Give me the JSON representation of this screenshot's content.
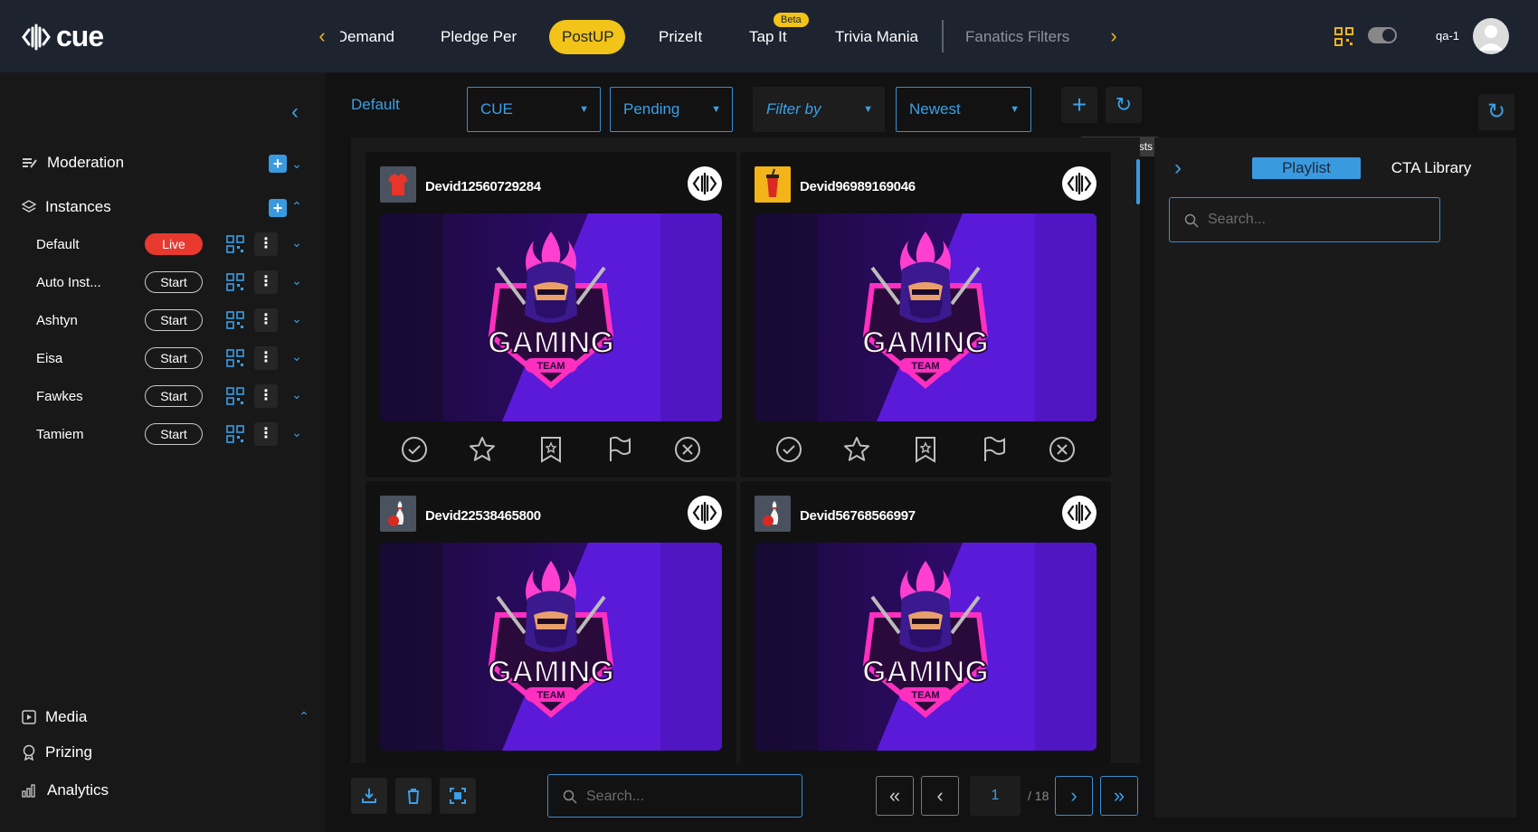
{
  "brand": {
    "name": "cue"
  },
  "nav": {
    "tabs": [
      {
        "label": "Demand",
        "state": "partial"
      },
      {
        "label": "Pledge Per",
        "state": "normal"
      },
      {
        "label": "PostUP",
        "state": "active"
      },
      {
        "label": "PrizeIt",
        "state": "normal"
      },
      {
        "label": "Tap It",
        "state": "normal",
        "badge": "Beta"
      },
      {
        "label": "Trivia Mania",
        "state": "normal"
      },
      {
        "label": "Fanatics Filters",
        "state": "disabled"
      }
    ],
    "prev_icon": "chevron-left-icon",
    "next_icon": "chevron-right-icon"
  },
  "header": {
    "username": "qa-1",
    "qr_icon": "qr-code-icon",
    "theme_toggle_icon": "theme-toggle-icon"
  },
  "sidebar": {
    "moderation_label": "Moderation",
    "instances_label": "Instances",
    "instances": [
      {
        "name": "Default",
        "status": "Live"
      },
      {
        "name": "Auto Inst...",
        "status": "Start"
      },
      {
        "name": "Ashtyn",
        "status": "Start"
      },
      {
        "name": "Eisa",
        "status": "Start"
      },
      {
        "name": "Fawkes",
        "status": "Start"
      },
      {
        "name": "Tamiem",
        "status": "Start"
      }
    ],
    "bottom_links": [
      {
        "label": "Media",
        "icon": "media-icon"
      },
      {
        "label": "Prizing",
        "icon": "prizing-icon"
      },
      {
        "label": "Analytics",
        "icon": "analytics-icon"
      }
    ]
  },
  "toolbar": {
    "breadcrumb": "Default",
    "filters": {
      "source": "CUE",
      "status": "Pending",
      "filter_by_placeholder": "Filter by",
      "sort": "Newest"
    },
    "update_posts_tooltip": "Update Posts"
  },
  "posts": [
    {
      "username": "Devid12560729284",
      "thumb": "shirt",
      "image_title": "GAMING",
      "image_subtitle": "TEAM"
    },
    {
      "username": "Devid96989169046",
      "thumb": "drink",
      "image_title": "GAMING",
      "image_subtitle": "TEAM"
    },
    {
      "username": "Devid22538465800",
      "thumb": "bowling",
      "image_title": "GAMING",
      "image_subtitle": "TEAM"
    },
    {
      "username": "Devid56768566997",
      "thumb": "bowling",
      "image_title": "GAMING",
      "image_subtitle": "TEAM"
    }
  ],
  "post_actions": [
    "approve-icon",
    "star-icon",
    "bookmark-icon",
    "flag-icon",
    "reject-icon"
  ],
  "bottom_bar": {
    "search_placeholder": "Search...",
    "page_current": "1",
    "page_total": "/ 18"
  },
  "right_panel": {
    "tabs": [
      {
        "label": "Playlist",
        "active": true
      },
      {
        "label": "CTA Library",
        "active": false
      }
    ],
    "search_placeholder": "Search..."
  },
  "colors": {
    "accent_blue": "#3a9ae0",
    "accent_yellow": "#f2c318",
    "live_red": "#e8392f",
    "header_bg": "#1d2430"
  }
}
